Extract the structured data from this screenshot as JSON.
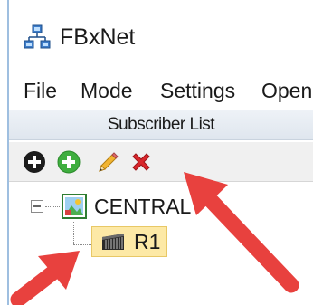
{
  "app": {
    "title": "FBxNet",
    "icon": "network-icon"
  },
  "menu": {
    "items": [
      {
        "label": "File"
      },
      {
        "label": "Mode"
      },
      {
        "label": "Settings"
      },
      {
        "label": "Open"
      }
    ]
  },
  "panel": {
    "header": "Subscriber List"
  },
  "toolbar": {
    "buttons": [
      {
        "icon": "add-black-circle-icon"
      },
      {
        "icon": "add-green-circle-icon"
      },
      {
        "icon": "pencil-icon"
      },
      {
        "icon": "delete-x-icon"
      }
    ]
  },
  "tree": {
    "root": {
      "label": "CENTRAL",
      "expanded": true
    },
    "children": [
      {
        "label": "R1",
        "selected": true
      }
    ]
  },
  "colors": {
    "annotation": "#e8413e",
    "selection": "#fde9a6",
    "delete": "#d9262b",
    "add_green": "#3fae3f"
  }
}
